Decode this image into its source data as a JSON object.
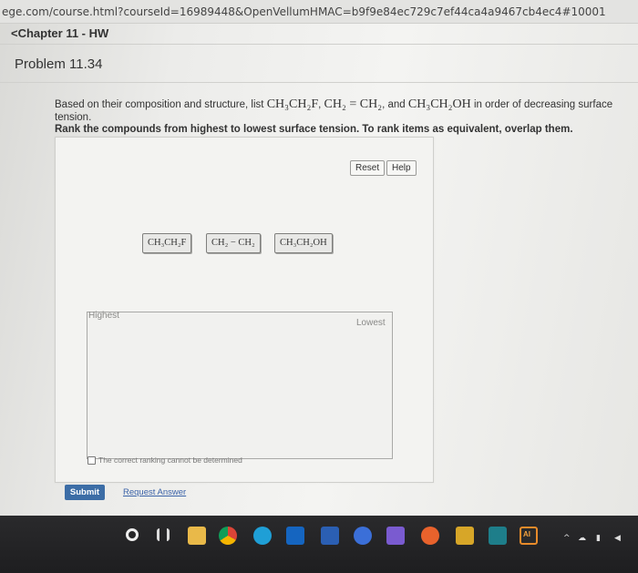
{
  "browser": {
    "url": "ege.com/course.html?courseId=16989448&OpenVellumHMAC=b9f9e84ec729c7ef44ca4a9467cb4ec4#10001"
  },
  "nav": {
    "chapter_link": "<Chapter 11 - HW"
  },
  "problem": {
    "title": "Problem 11.34",
    "question_prefix": "Based on their composition and structure, list",
    "compound1": "CH₃CH₂F",
    "compound2": "CH₂ = CH₂",
    "and_word": "and",
    "compound3": "CH₃CH₂OH",
    "question_suffix": "in order of decreasing surface tension.",
    "instruction": "Rank the compounds from highest to lowest surface tension. To rank items as equivalent, overlap them."
  },
  "widget": {
    "reset_label": "Reset",
    "help_label": "Help",
    "tiles": [
      "CH₃CH₂F",
      "CH₂ − CH₂",
      "CH₃CH₂OH"
    ],
    "highest_label": "Highest",
    "lowest_label": "Lowest",
    "cannot_determine_label": "The correct ranking cannot be determined"
  },
  "actions": {
    "submit_label": "Submit",
    "request_answer_label": "Request Answer"
  },
  "taskbar": {
    "ai_label": "AI"
  },
  "colors": {
    "submit_bg": "#3c6da6",
    "link": "#3b63a8",
    "taskbar_bg": "#222224"
  }
}
